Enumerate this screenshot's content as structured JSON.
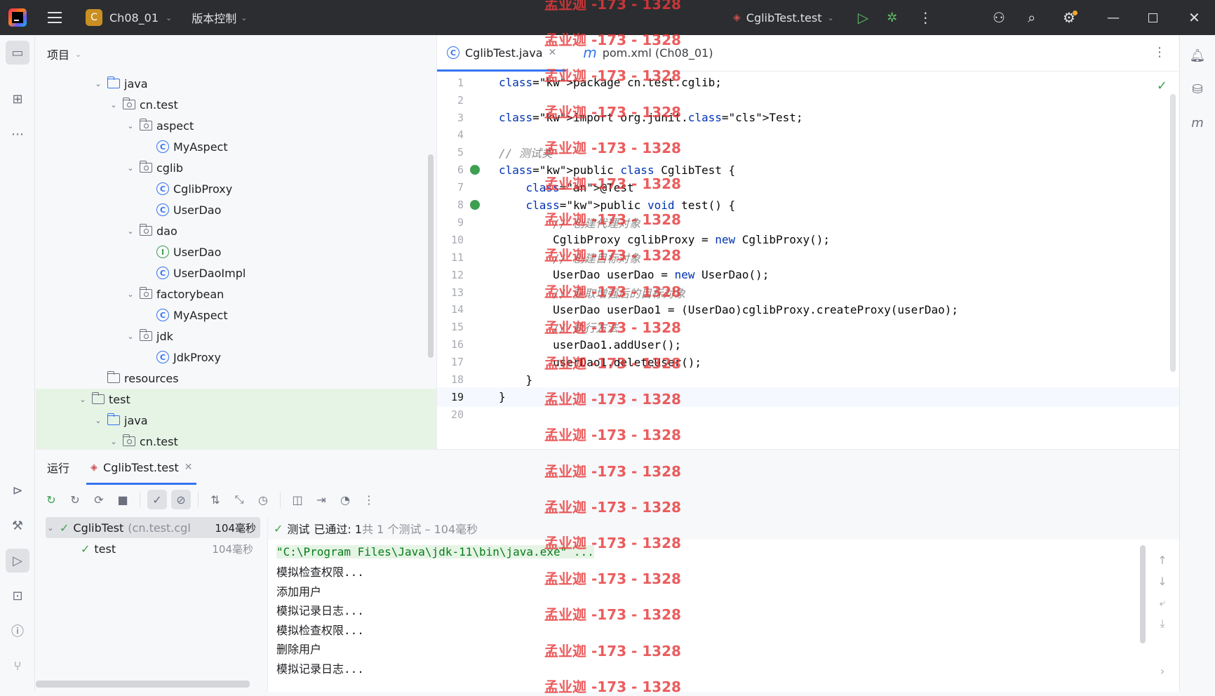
{
  "titlebar": {
    "project_badge": "C",
    "project_name": "Ch08_01",
    "vcs_label": "版本控制",
    "run_config": "CglibTest.test"
  },
  "project_panel": {
    "title": "项目",
    "tree": [
      {
        "label": "java",
        "kind": "folder-blue",
        "expanded": true
      },
      {
        "label": "cn.test",
        "kind": "package",
        "expanded": true
      },
      {
        "label": "aspect",
        "kind": "package",
        "expanded": true
      },
      {
        "label": "MyAspect",
        "kind": "class"
      },
      {
        "label": "cglib",
        "kind": "package",
        "expanded": true
      },
      {
        "label": "CglibProxy",
        "kind": "class"
      },
      {
        "label": "UserDao",
        "kind": "class"
      },
      {
        "label": "dao",
        "kind": "package",
        "expanded": true
      },
      {
        "label": "UserDao",
        "kind": "interface"
      },
      {
        "label": "UserDaoImpl",
        "kind": "class"
      },
      {
        "label": "factorybean",
        "kind": "package",
        "expanded": true
      },
      {
        "label": "MyAspect",
        "kind": "class"
      },
      {
        "label": "jdk",
        "kind": "package",
        "expanded": true
      },
      {
        "label": "JdkProxy",
        "kind": "class"
      },
      {
        "label": "resources",
        "kind": "folder"
      },
      {
        "label": "test",
        "kind": "folder",
        "expanded": true
      },
      {
        "label": "java",
        "kind": "folder-blue",
        "expanded": true
      },
      {
        "label": "cn.test",
        "kind": "package",
        "expanded": true
      }
    ]
  },
  "editor": {
    "tabs": [
      {
        "label": "CglibTest.java",
        "icon": "C",
        "active": true
      },
      {
        "label": "pom.xml (Ch08_01)",
        "icon": "m",
        "active": false
      }
    ],
    "lines": [
      {
        "n": "1",
        "text": "package cn.test.cglib;"
      },
      {
        "n": "2",
        "text": ""
      },
      {
        "n": "3",
        "text": "import org.junit.Test;"
      },
      {
        "n": "4",
        "text": ""
      },
      {
        "n": "5",
        "text": "// 测试类"
      },
      {
        "n": "6",
        "text": "public class CglibTest {"
      },
      {
        "n": "7",
        "text": "    @Test"
      },
      {
        "n": "8",
        "text": "    public void test() {"
      },
      {
        "n": "9",
        "text": "        // 创建代理对象"
      },
      {
        "n": "10",
        "text": "        CglibProxy cglibProxy = new CglibProxy();"
      },
      {
        "n": "11",
        "text": "        // 创建目标对象"
      },
      {
        "n": "12",
        "text": "        UserDao userDao = new UserDao();"
      },
      {
        "n": "13",
        "text": "        // 获取增强后的目标对象"
      },
      {
        "n": "14",
        "text": "        UserDao userDao1 = (UserDao)cglibProxy.createProxy(userDao);"
      },
      {
        "n": "15",
        "text": "        // 执行方法"
      },
      {
        "n": "16",
        "text": "        userDao1.addUser();"
      },
      {
        "n": "17",
        "text": "        userDao1.deleteUser();"
      },
      {
        "n": "18",
        "text": "    }"
      },
      {
        "n": "19",
        "text": "}"
      },
      {
        "n": "20",
        "text": ""
      }
    ]
  },
  "run_panel": {
    "title": "运行",
    "tab_label": "CglibTest.test",
    "tree": [
      {
        "label": "CglibTest",
        "detail": "(cn.test.cglib",
        "time": "104毫秒"
      },
      {
        "label": "test",
        "detail": "",
        "time": "104毫秒"
      }
    ],
    "status_prefix": "测试",
    "status_passed": "已通过: 1",
    "status_suffix": "共 1 个测试 – 104毫秒",
    "console": [
      "\"C:\\Program Files\\Java\\jdk-11\\bin\\java.exe\" ...",
      "模拟检查权限...",
      "添加用户",
      "模拟记录日志...",
      "模拟检查权限...",
      "删除用户",
      "模拟记录日志..."
    ]
  },
  "watermark": "孟业迦 -173 - 1328",
  "colors": {
    "accent": "#3574f0",
    "success": "#3e9f51",
    "watermark": "#e8393a"
  }
}
